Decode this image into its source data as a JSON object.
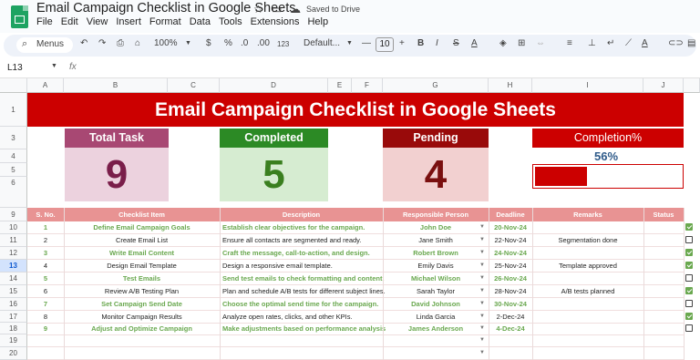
{
  "app": {
    "doc_title": "Email Campaign Checklist in Google Sheets",
    "saved_status": "Saved to Drive",
    "menu": [
      "File",
      "Edit",
      "View",
      "Insert",
      "Format",
      "Data",
      "Tools",
      "Extensions",
      "Help"
    ]
  },
  "toolbar": {
    "menus_label": "Menus",
    "zoom": "100%",
    "currency": "$",
    "percent": "%",
    "decimal_dec": ".0",
    "decimal_inc": ".00",
    "number_format": "123",
    "font": "Default...",
    "font_size": "10"
  },
  "formula_bar": {
    "name_box": "L13",
    "fx": "fx"
  },
  "columns": [
    "A",
    "B",
    "C",
    "D",
    "E",
    "F",
    "G",
    "H",
    "I",
    "J"
  ],
  "rows": [
    "1",
    "3",
    "4",
    "5",
    "6",
    "9",
    "10",
    "11",
    "12",
    "13",
    "14",
    "15",
    "16",
    "17",
    "18",
    "19",
    "20"
  ],
  "sheet": {
    "banner": "Email Campaign Checklist in Google Sheets",
    "cards": {
      "total": {
        "label": "Total Task",
        "value": "9"
      },
      "completed": {
        "label": "Completed",
        "value": "5"
      },
      "pending": {
        "label": "Pending",
        "value": "4"
      },
      "completion": {
        "label": "Completion%",
        "value": "56%",
        "fraction": 0.56
      }
    },
    "table_headers": [
      "S. No.",
      "Checklist Item",
      "Description",
      "Responsible Person",
      "Deadline",
      "Remarks",
      "Status"
    ],
    "tasks": [
      {
        "no": "1",
        "item": "Define Email Campaign Goals",
        "desc": "Establish clear objectives for the campaign.",
        "person": "John Doe",
        "deadline": "20-Nov-24",
        "remarks": "",
        "done": true
      },
      {
        "no": "2",
        "item": "Create Email List",
        "desc": "Ensure all contacts are segmented and ready.",
        "person": "Jane Smith",
        "deadline": "22-Nov-24",
        "remarks": "Segmentation done",
        "done": false
      },
      {
        "no": "3",
        "item": "Write Email Content",
        "desc": "Craft the message, call-to-action, and design.",
        "person": "Robert Brown",
        "deadline": "24-Nov-24",
        "remarks": "",
        "done": true
      },
      {
        "no": "4",
        "item": "Design Email Template",
        "desc": "Design a responsive email template.",
        "person": "Emily Davis",
        "deadline": "25-Nov-24",
        "remarks": "Template approved",
        "done": true
      },
      {
        "no": "5",
        "item": "Test Emails",
        "desc": "Send test emails to check formatting and content.",
        "person": "Michael Wilson",
        "deadline": "26-Nov-24",
        "remarks": "",
        "done": false
      },
      {
        "no": "6",
        "item": "Review A/B Testing Plan",
        "desc": "Plan and schedule A/B tests for different subject lines.",
        "person": "Sarah Taylor",
        "deadline": "28-Nov-24",
        "remarks": "A/B tests planned",
        "done": true
      },
      {
        "no": "7",
        "item": "Set Campaign Send Date",
        "desc": "Choose the optimal send time for the campaign.",
        "person": "David Johnson",
        "deadline": "30-Nov-24",
        "remarks": "",
        "done": false
      },
      {
        "no": "8",
        "item": "Monitor Campaign Results",
        "desc": "Analyze open rates, clicks, and other KPIs.",
        "person": "Linda Garcia",
        "deadline": "2-Dec-24",
        "remarks": "",
        "done": true
      },
      {
        "no": "9",
        "item": "Adjust and Optimize Campaign",
        "desc": "Make adjustments based on performance analysis.",
        "person": "James Anderson",
        "deadline": "4-Dec-24",
        "remarks": "",
        "done": false
      }
    ]
  },
  "colors": {
    "accent_red": "#cc0000",
    "header_pink": "#e89393",
    "done_green": "#6aa84f",
    "sheets_green": "#1ea362"
  }
}
